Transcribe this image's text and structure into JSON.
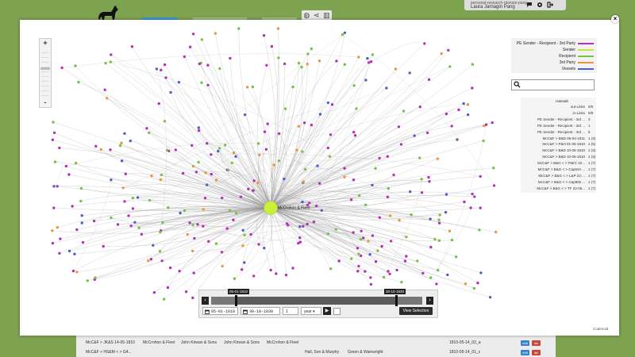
{
  "header": {
    "view_icons": [
      "globe-icon",
      "share-network-icon",
      "bar-chart-icon"
    ],
    "user_domain": "personal-research-domain-pang",
    "user_name": "Laura Jarnagin Pang",
    "user_icons": [
      "chat-icon",
      "gear-icon",
      "logout-icon"
    ]
  },
  "background_table": {
    "rows": [
      {
        "title": "McC&F > JK&S 14-05-1810",
        "c1": "McCrohon & Fleet",
        "c2": "John Kirwan & Sons",
        "c3": "John Kirwan & Sons",
        "c4": "McCrohon & Fleet",
        "date": "1810-05-14_02_a"
      },
      {
        "title": "McC&F > HS&M < > G4...",
        "c1": "",
        "c2": "",
        "c3": "Hall, Son & Murphy",
        "c4": "Green & Wainwright",
        "date": "1810-05-14_01_c"
      }
    ],
    "edit_label": "edit",
    "del_label": "del"
  },
  "graph": {
    "center_label": "McCrohon & Fleet",
    "colors": {
      "pe_sender": "#b333b3",
      "sender": "#bfea3a",
      "recipient": "#7ac043",
      "third_party": "#e49a3c",
      "vessels": "#4a63c9",
      "center": "#c8ef3a"
    }
  },
  "legend": {
    "items": [
      {
        "label": "PE Sender - Recipient - 3rd Party",
        "color": "#b333b3"
      },
      {
        "label": "Sender",
        "color": "#bfea3a"
      },
      {
        "label": "Recipient",
        "color": "#7ac043"
      },
      {
        "label": "3rd Party",
        "color": "#e49a3c"
      },
      {
        "label": "Vessels",
        "color": "#4a63c9"
      }
    ]
  },
  "search": {
    "placeholder": ""
  },
  "info": {
    "title": "Hannah",
    "rows": [
      {
        "k": "out-Links",
        "v": "0/0"
      },
      {
        "k": "in-Links",
        "v": "9/9"
      },
      {
        "k": "PE Sender - Recipient - 3rd ...",
        "v": "3"
      },
      {
        "k": "PE Sender - Recipient - 3rd ...",
        "v": "1"
      },
      {
        "k": "PE Sender - Recipient - 3rd ...",
        "v": "5"
      },
      {
        "k": "McC&F > B&D 06-04-1811",
        "v": "1 (3)"
      },
      {
        "k": "McC&F > P&H 01-06-1810",
        "v": "1 (5)"
      },
      {
        "k": "McC&F > B&D 10-05-1810",
        "v": "1 (3)"
      },
      {
        "k": "McC&F > B&D 10-05-1810",
        "v": "1 (3)"
      },
      {
        "k": "McC&F > B&G < > FMrC 22...",
        "v": "1 (7)"
      },
      {
        "k": "McC&F > B&G < > CaptSH ...",
        "v": "1 (7)"
      },
      {
        "k": "McC&F > B&G < > L&P 22-...",
        "v": "1 (7)"
      },
      {
        "k": "McC&F > B&G < > CaptEB ...",
        "v": "1 (7)"
      },
      {
        "k": "McC&F > B&G < > TF 22-05...",
        "v": "1 (7)"
      }
    ]
  },
  "timeline": {
    "start_label": "05-01-1810",
    "end_label": "30-10-1830",
    "start_date": "05-01-1810",
    "end_date": "30-10-1830",
    "step_value": "1",
    "unit": "year",
    "view_selection": "View Selection",
    "prev": "‹",
    "next": "›",
    "play": "▶"
  },
  "credit": "Codenoid",
  "zoom": {
    "plus": "+",
    "minus": "-"
  },
  "close_label": "×"
}
